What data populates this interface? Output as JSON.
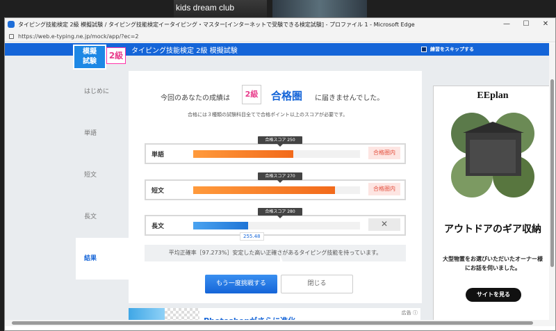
{
  "video": {
    "participant_name": "kids dream club"
  },
  "window": {
    "title": "タイピング技能検定 2級 模擬試験 / タイピング技能検定イータイピング・マスター[インターネットで受験できる検定試験] - プロファイル 1 - Microsoft Edge",
    "url": "https://web.e-typing.ne.jp/mock/app/?ec=2"
  },
  "nav": {
    "logo_line1": "模擬",
    "logo_line2": "試験",
    "grade": "2級",
    "title": "タイピング技能検定 2級 模擬試験",
    "skip_label": "練習をスキップする"
  },
  "sidebar": {
    "items": [
      {
        "label": "はじめに"
      },
      {
        "label": "単語"
      },
      {
        "label": "短文"
      },
      {
        "label": "長文"
      },
      {
        "label": "結果"
      }
    ]
  },
  "result": {
    "prefix": "今回のあなたの成績は",
    "grade": "2級",
    "zone": "合格圏",
    "suffix": "に届きませんでした。",
    "note": "合格には３種類の試験科目全てで合格ポイント以上のスコアが必要です。",
    "rows": [
      {
        "label": "単語",
        "tip": "合格スコア 250",
        "status": "合格圏内",
        "fill": 0.6
      },
      {
        "label": "短文",
        "tip": "合格スコア 270",
        "status": "合格圏内",
        "fill": 0.85
      },
      {
        "label": "長文",
        "tip": "合格スコア 280",
        "status": "✕",
        "fill": 0.33
      }
    ],
    "score_value": "255.48",
    "comment": "平均正確率［97.273%］安定した高い正確さがあるタイピング技能を持っています。",
    "retry_button": "もう一度挑戦する",
    "close_button": "閉じる"
  },
  "ad": {
    "brand": "EEplan",
    "headline": "アウトドアのギア収納",
    "sub": "大型物置をお選びいただいたオーナー様にお話を伺いました。",
    "button": "サイトを見る"
  },
  "bottom_ad": {
    "text": "Photoshopがさらに進化",
    "label": "広告 ⓘ"
  }
}
